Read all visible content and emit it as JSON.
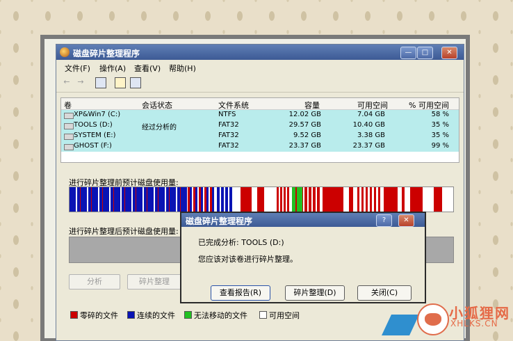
{
  "window": {
    "title": "磁盘碎片整理程序",
    "minimize": "—",
    "maximize": "□",
    "close": "✕"
  },
  "menu": [
    "文件(F)",
    "操作(A)",
    "查看(V)",
    "帮助(H)"
  ],
  "toolbar": {
    "back": "←",
    "forward": "→"
  },
  "columns": [
    "卷",
    "会话状态",
    "文件系统",
    "容量",
    "可用空间",
    "% 可用空间"
  ],
  "volumes": [
    {
      "name": "XP&Win7 (C:)",
      "status": "",
      "fs": "NTFS",
      "capacity": "12.02 GB",
      "free": "7.04 GB",
      "pct": "58 %"
    },
    {
      "name": "TOOLS (D:)",
      "status": "经过分析的",
      "fs": "FAT32",
      "capacity": "29.57 GB",
      "free": "10.40 GB",
      "pct": "35 %"
    },
    {
      "name": "SYSTEM (E:)",
      "status": "",
      "fs": "FAT32",
      "capacity": "9.52 GB",
      "free": "3.38 GB",
      "pct": "35 %"
    },
    {
      "name": "GHOST (F:)",
      "status": "",
      "fs": "FAT32",
      "capacity": "23.37 GB",
      "free": "23.37 GB",
      "pct": "99 %"
    }
  ],
  "before_label": "进行碎片整理前预计磁盘使用量:",
  "after_label": "进行碎片整理后预计磁盘使用量:",
  "buttons": {
    "analyze": "分析",
    "defrag": "碎片整理"
  },
  "legend": [
    {
      "label": "零碎的文件",
      "color": "#cc0000"
    },
    {
      "label": "连续的文件",
      "color": "#0a14b4"
    },
    {
      "label": "无法移动的文件",
      "color": "#22c022"
    },
    {
      "label": "可用空间",
      "color": "#ffffff"
    }
  ],
  "dialog": {
    "title": "磁盘碎片整理程序",
    "help": "?",
    "close": "✕",
    "line1": "已完成分析: TOOLS (D:)",
    "line2": "您应该对该卷进行碎片整理。",
    "view_report": "查看报告(R)",
    "defrag": "碎片整理(D)",
    "close_btn": "关闭(C)"
  },
  "watermark": {
    "text": "小狐狸网",
    "domain": "XHLKS.CN"
  }
}
